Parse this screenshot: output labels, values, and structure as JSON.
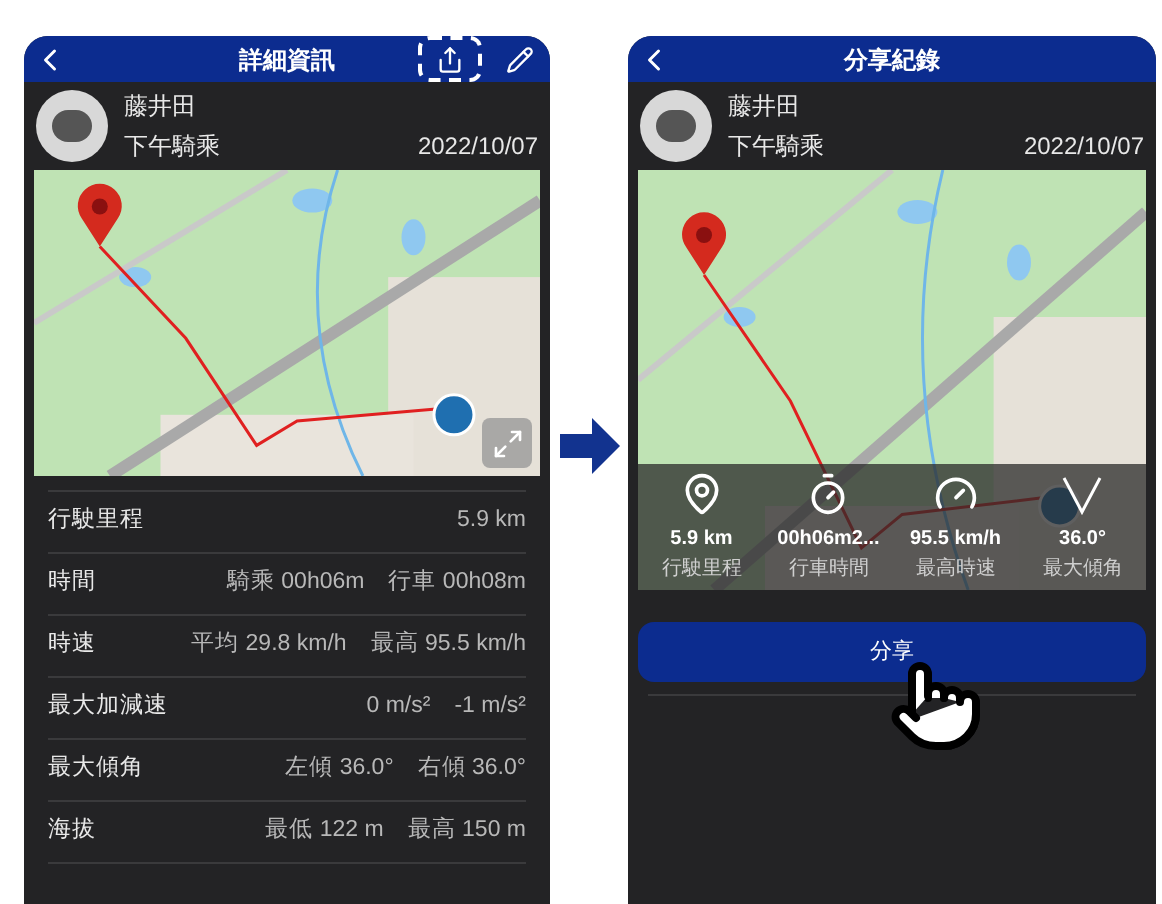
{
  "detail": {
    "title": "詳細資訊",
    "rider": "藤井田",
    "ride_name": "下午騎乘",
    "date": "2022/10/07",
    "stats": [
      {
        "label": "行駛里程",
        "values": [
          "5.9 km"
        ]
      },
      {
        "label": "時間",
        "values": [
          "騎乘 00h06m",
          "行車 00h08m"
        ]
      },
      {
        "label": "時速",
        "values": [
          "平均 29.8 km/h",
          "最高 95.5 km/h"
        ]
      },
      {
        "label": "最大加減速",
        "values": [
          "0 m/s²",
          "-1 m/s²"
        ]
      },
      {
        "label": "最大傾角",
        "values": [
          "左傾 36.0°",
          "右傾 36.0°"
        ]
      },
      {
        "label": "海拔",
        "values": [
          "最低 122 m",
          "最高 150 m"
        ]
      }
    ]
  },
  "share": {
    "title": "分享紀錄",
    "rider": "藤井田",
    "ride_name": "下午騎乘",
    "date": "2022/10/07",
    "overlay": [
      {
        "kind": "distance",
        "value": "5.9 km",
        "label": "行駛里程"
      },
      {
        "kind": "time",
        "value": "00h06m2...",
        "label": "行車時間"
      },
      {
        "kind": "speed",
        "value": "95.5 km/h",
        "label": "最高時速"
      },
      {
        "kind": "lean",
        "value": "36.0°",
        "label": "最大傾角"
      }
    ],
    "button": "分享"
  }
}
